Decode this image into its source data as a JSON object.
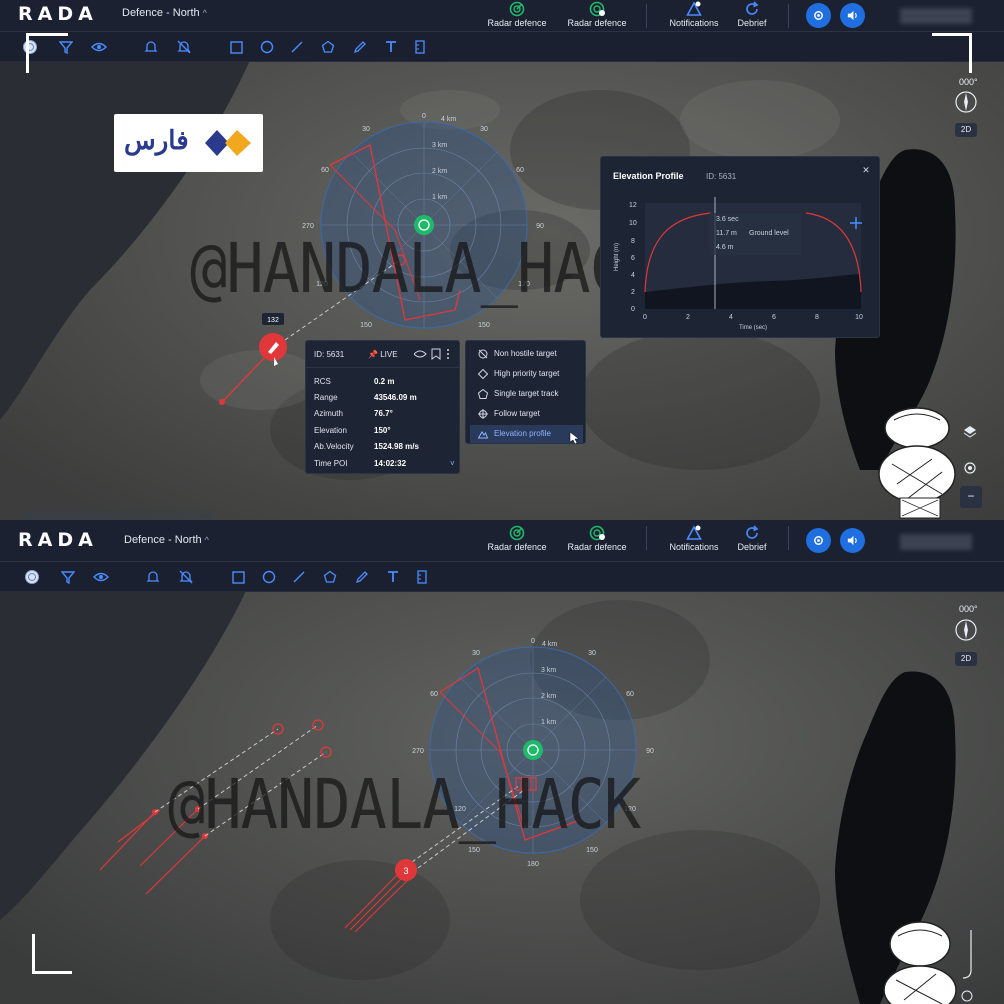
{
  "app": {
    "name": "RADA"
  },
  "header": {
    "region_label": "Defence - North",
    "buttons": {
      "radar_defence_1": "Radar defence",
      "radar_defence_2": "Radar defence",
      "notifications": "Notifications",
      "debrief": "Debrief"
    }
  },
  "map": {
    "compass_heading": "000°",
    "view_mode": "2D",
    "watermark": "@HANDALA_HACK",
    "radar_top": {
      "bearing_labels": [
        "0",
        "30",
        "60",
        "90",
        "120",
        "150",
        "270"
      ],
      "range_labels": [
        "4 km",
        "3 km",
        "2 km",
        "1 km"
      ]
    },
    "radar_bottom": {
      "bearing_labels": [
        "0",
        "30",
        "60",
        "90",
        "120",
        "150",
        "180",
        "270"
      ],
      "range_labels": [
        "4 km",
        "3 km",
        "2 km",
        "1 km"
      ]
    },
    "target_top": {
      "label": "132"
    },
    "target_bottom": {
      "count": "3"
    }
  },
  "target_card": {
    "id": "ID: 5631",
    "status": "LIVE",
    "fields": [
      {
        "key": "RCS",
        "value": "0.2 m"
      },
      {
        "key": "Range",
        "value": "43546.09 m"
      },
      {
        "key": "Azimuth",
        "value": "76.7°"
      },
      {
        "key": "Elevation",
        "value": "150°"
      },
      {
        "key": "Ab.Velocity",
        "value": "1524.98 m/s"
      },
      {
        "key": "Time POI",
        "value": "14:02:32"
      }
    ]
  },
  "context_menu": {
    "items": [
      "Non hostile target",
      "High priority target",
      "Single target track",
      "Follow target",
      "Elevation profile"
    ],
    "selected": "Elevation profile"
  },
  "elevation_profile": {
    "title": "Elevation Profile",
    "id": "ID: 5631",
    "tooltip_time": "3.6 sec",
    "tooltip_height": "11.7 m",
    "tooltip_ground_label": "Ground level",
    "tooltip_ground": "4.6 m",
    "xlabel": "Time (sec)",
    "ylabel": "Height (m)",
    "x_ticks": [
      "0",
      "2",
      "4",
      "6",
      "8",
      "10"
    ],
    "y_ticks": [
      "12",
      "10",
      "8",
      "6",
      "4",
      "2",
      "0"
    ]
  },
  "colors": {
    "accent": "#1f6fe0",
    "hostile": "#e0383a",
    "radar_green": "#1fb96b",
    "panel_bg": "#1d2433"
  }
}
